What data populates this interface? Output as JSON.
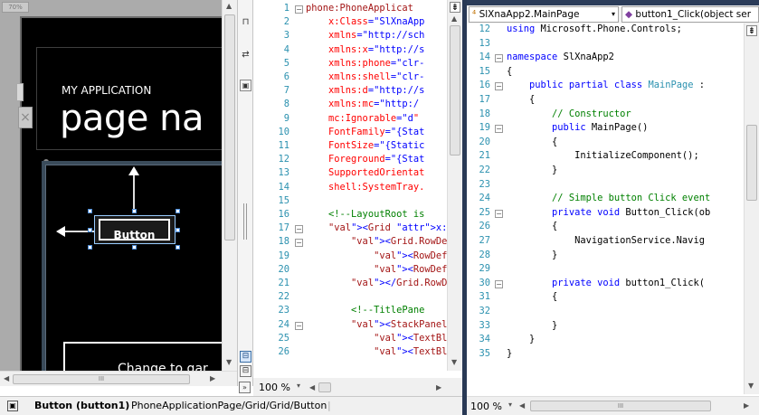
{
  "designer": {
    "zoom_badge": "70%",
    "app_name": "MY APPLICATION",
    "page_name": "page na",
    "button_text": "Button",
    "change_text": "Change to gar",
    "hscroll_mark": "III"
  },
  "xaml": {
    "zoom": "100 %",
    "lines": [
      {
        "n": "1",
        "t": "phone:PhoneApplicat"
      },
      {
        "n": "2",
        "t": "    x:Class=\"SlXnaApp"
      },
      {
        "n": "3",
        "t": "    xmlns=\"http://sch"
      },
      {
        "n": "4",
        "t": "    xmlns:x=\"http://s"
      },
      {
        "n": "5",
        "t": "    xmlns:phone=\"clr-"
      },
      {
        "n": "6",
        "t": "    xmlns:shell=\"clr-"
      },
      {
        "n": "7",
        "t": "    xmlns:d=\"http://s"
      },
      {
        "n": "8",
        "t": "    xmlns:mc=\"http:/"
      },
      {
        "n": "9",
        "t": "    mc:Ignorable=\"d\""
      },
      {
        "n": "10",
        "t": "    FontFamily=\"{Stat"
      },
      {
        "n": "11",
        "t": "    FontSize=\"{Static"
      },
      {
        "n": "12",
        "t": "    Foreground=\"{Stat"
      },
      {
        "n": "13",
        "t": "    SupportedOrientat"
      },
      {
        "n": "14",
        "t": "    shell:SystemTray."
      },
      {
        "n": "15",
        "t": ""
      },
      {
        "n": "16",
        "t": "    <!--LayoutRoot is"
      },
      {
        "n": "17",
        "t": "    <Grid x:Name=\"Lay"
      },
      {
        "n": "18",
        "t": "        <Grid.RowDefi"
      },
      {
        "n": "19",
        "t": "            <RowDefir"
      },
      {
        "n": "20",
        "t": "            <RowDefir"
      },
      {
        "n": "21",
        "t": "        </Grid.RowDef"
      },
      {
        "n": "22",
        "t": ""
      },
      {
        "n": "23",
        "t": "        <!--TitlePane"
      },
      {
        "n": "24",
        "t": "        <StackPanel x"
      },
      {
        "n": "25",
        "t": "            <TextBloc"
      },
      {
        "n": "26",
        "t": "            <TextBloc"
      }
    ]
  },
  "code": {
    "class_combo": "SlXnaApp2.MainPage",
    "member_combo": "button1_Click(object ser",
    "zoom": "100 %",
    "hscroll_mark": "III",
    "lines": [
      {
        "n": "12",
        "t": "using Microsoft.Phone.Controls;"
      },
      {
        "n": "13",
        "t": ""
      },
      {
        "n": "14",
        "t": "namespace SlXnaApp2"
      },
      {
        "n": "15",
        "t": "{"
      },
      {
        "n": "16",
        "t": "    public partial class MainPage :"
      },
      {
        "n": "17",
        "t": "    {"
      },
      {
        "n": "18",
        "t": "        // Constructor"
      },
      {
        "n": "19",
        "t": "        public MainPage()"
      },
      {
        "n": "20",
        "t": "        {"
      },
      {
        "n": "21",
        "t": "            InitializeComponent();"
      },
      {
        "n": "22",
        "t": "        }"
      },
      {
        "n": "23",
        "t": ""
      },
      {
        "n": "24",
        "t": "        // Simple button Click event"
      },
      {
        "n": "25",
        "t": "        private void Button_Click(ob"
      },
      {
        "n": "26",
        "t": "        {"
      },
      {
        "n": "27",
        "t": "            NavigationService.Navig"
      },
      {
        "n": "28",
        "t": "        }"
      },
      {
        "n": "29",
        "t": ""
      },
      {
        "n": "30",
        "t": "        private void button1_Click("
      },
      {
        "n": "31",
        "t": "        {"
      },
      {
        "n": "32",
        "t": ""
      },
      {
        "n": "33",
        "t": "        }"
      },
      {
        "n": "34",
        "t": "    }"
      },
      {
        "n": "35",
        "t": "}"
      }
    ]
  },
  "status": {
    "element": "Button (button1)",
    "path": "PhoneApplicationPage/Grid/Grid/Button"
  }
}
